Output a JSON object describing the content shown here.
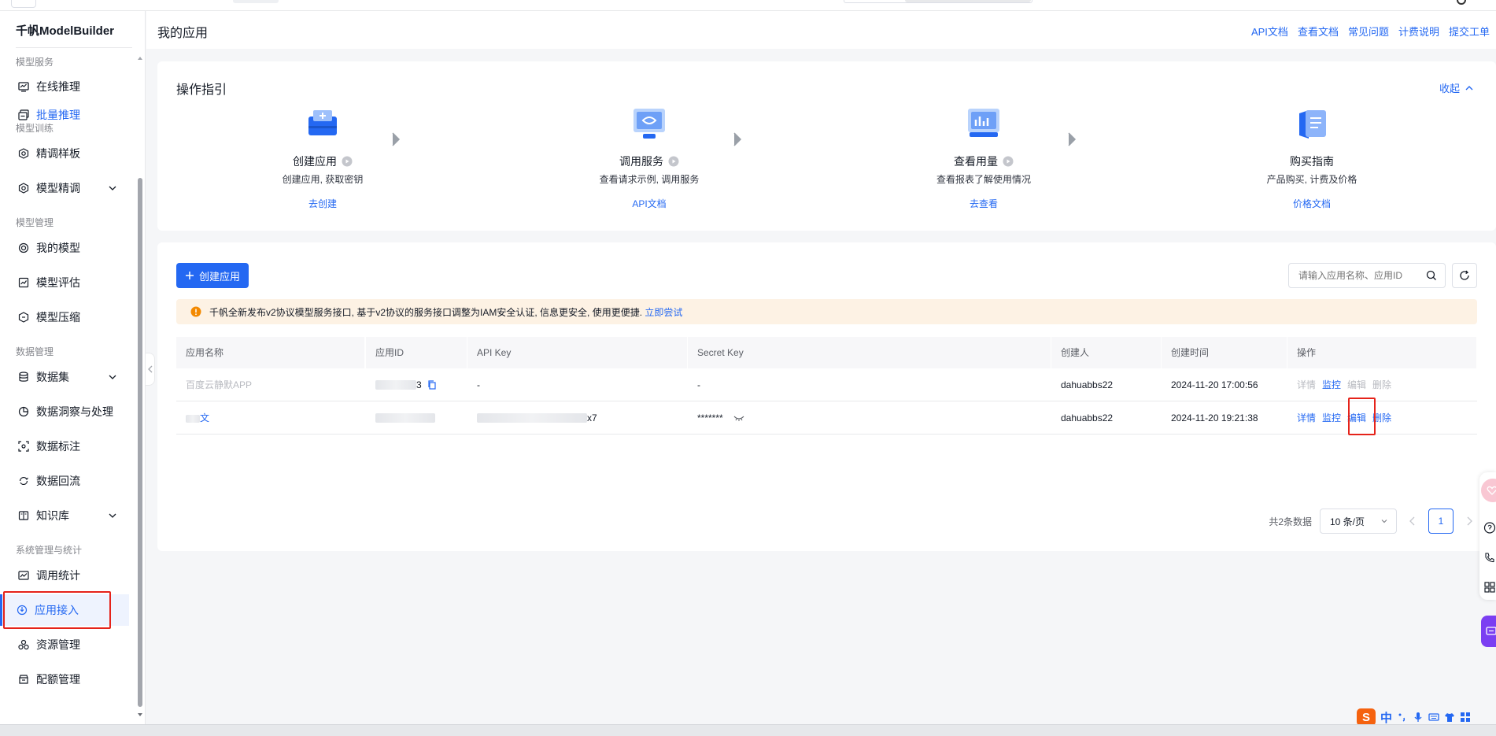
{
  "brand": "千帆ModelBuilder",
  "sidebar": {
    "groups": {
      "service": "模型服务",
      "training": "模型训练",
      "management": "模型管理",
      "data": "数据管理",
      "system": "系统管理与统计"
    },
    "items": {
      "online_infer": "在线推理",
      "batch_infer": "批量推理",
      "finetune_template": "精调样板",
      "model_finetune": "模型精调",
      "my_models": "我的模型",
      "model_eval": "模型评估",
      "model_compress": "模型压缩",
      "dataset": "数据集",
      "data_insight": "数据洞察与处理",
      "data_label": "数据标注",
      "data_backflow": "数据回流",
      "knowledge": "知识库",
      "call_stats": "调用统计",
      "app_access": "应用接入",
      "resource_mgmt": "资源管理",
      "quota_mgmt": "配额管理"
    }
  },
  "header": {
    "title": "我的应用",
    "links": [
      "API文档",
      "查看文档",
      "常见问题",
      "计费说明",
      "提交工单"
    ]
  },
  "guide": {
    "title": "操作指引",
    "collapse": "收起",
    "steps": [
      {
        "title": "创建应用",
        "desc": "创建应用, 获取密钥",
        "link": "去创建"
      },
      {
        "title": "调用服务",
        "desc": "查看请求示例, 调用服务",
        "link": "API文档"
      },
      {
        "title": "查看用量",
        "desc": "查看报表了解使用情况",
        "link": "去查看"
      },
      {
        "title": "购买指南",
        "desc": "产品购买, 计费及价格",
        "link": "价格文档"
      }
    ]
  },
  "list": {
    "create_button": "创建应用",
    "search_placeholder": "请输入应用名称、应用ID",
    "notice": "千帆全新发布v2协议模型服务接口, 基于v2协议的服务接口调整为IAM安全认证, 信息更安全, 使用更便捷.",
    "notice_link": "立即尝试",
    "columns": [
      "应用名称",
      "应用ID",
      "API Key",
      "Secret Key",
      "创建人",
      "创建时间",
      "操作"
    ],
    "rows": [
      {
        "name": "百度云静默APP",
        "app_id_suffix": "3",
        "api_key": "-",
        "secret_key": "-",
        "creator": "dahuabbs22",
        "created": "2024-11-20 17:00:56",
        "actions": [
          "详情",
          "监控",
          "编辑",
          "删除"
        ]
      },
      {
        "name": "文",
        "app_id_suffix": "",
        "api_key_suffix": "x7",
        "secret_key": "*******",
        "creator": "dahuabbs22",
        "created": "2024-11-20 19:21:38",
        "actions": [
          "详情",
          "监控",
          "编辑",
          "删除"
        ]
      }
    ],
    "total": "共2条数据",
    "page_size": "10 条/页",
    "current_page": "1"
  },
  "ime": {
    "zh": "中"
  },
  "colors": {
    "primary": "#2468f2",
    "highlight": "#e5231a",
    "notice_bg": "#fdf2e4"
  }
}
